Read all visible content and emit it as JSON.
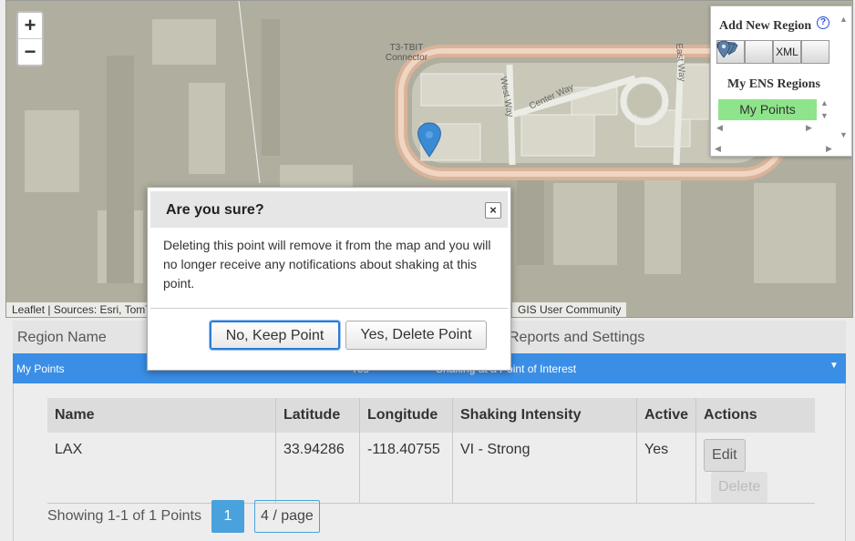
{
  "map": {
    "zoom_in": "+",
    "zoom_out": "−",
    "label_connector": "T3-TBIT\nConnector",
    "road_west": "West Way",
    "road_center": "Center Way",
    "road_east": "East Way",
    "attribution": "Leaflet | Sources: Esri, TomT",
    "attribution_end": "GIS User Community"
  },
  "region_panel": {
    "add_title": "Add New Region",
    "help": "?",
    "buttons": [
      {
        "icon": "us-map-icon"
      },
      {
        "icon": "polygon-icon"
      },
      {
        "label": "XML"
      },
      {
        "icon": "location-pin-icon"
      }
    ],
    "my_regions_title": "My ENS Regions",
    "regions": [
      "My Points"
    ]
  },
  "table_header": {
    "region_name": "Region Name",
    "reports": "Reports and Settings"
  },
  "region_row": {
    "name": "My Points",
    "active": "Yes",
    "type": "Shaking at a Point of Interest"
  },
  "points_table": {
    "columns": [
      "Name",
      "Latitude",
      "Longitude",
      "Shaking Intensity",
      "Active",
      "Actions"
    ],
    "rows": [
      {
        "name": "LAX",
        "latitude": "33.94286",
        "longitude": "-118.40755",
        "intensity": "VI - Strong",
        "active": "Yes"
      }
    ],
    "edit_label": "Edit",
    "delete_label": "Delete"
  },
  "pager": {
    "summary": "Showing 1-1 of 1 Points",
    "current_page": "1",
    "page_size": "4 / page"
  },
  "dialog": {
    "title": "Are you sure?",
    "close": "×",
    "message": "Deleting this point will remove it from the map and you will no longer receive any notifications about shaking at this point.",
    "keep_label": "No, Keep Point",
    "delete_label": "Yes, Delete Point"
  },
  "colors": {
    "accent_blue": "#3a8ee6",
    "region_green": "#8ee48a",
    "pager_blue": "#4aa2dc"
  }
}
